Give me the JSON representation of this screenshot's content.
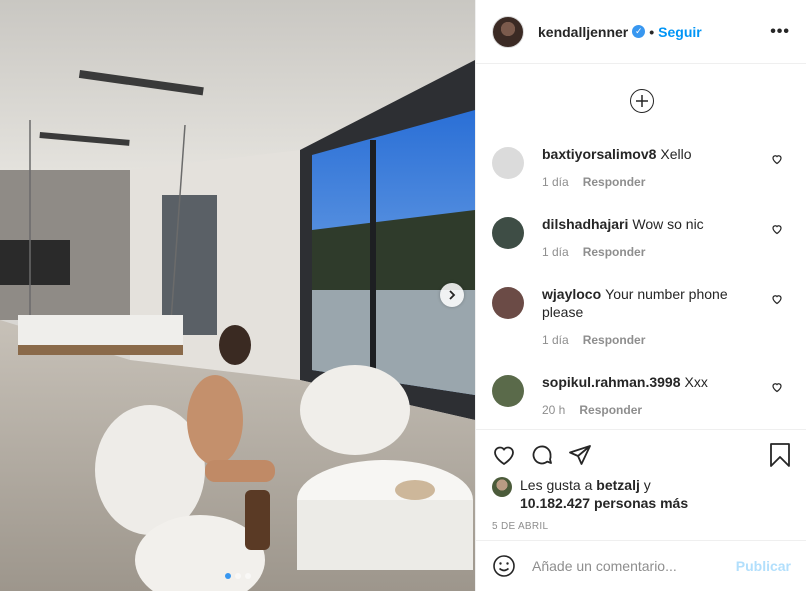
{
  "post": {
    "username": "kendalljenner",
    "verified_icon": "verified-badge-icon",
    "separator": "•",
    "follow_label": "Seguir",
    "more_icon": "more-options-icon"
  },
  "comments": [
    {
      "user": "baxtiyorsalimov8",
      "text": "Xello",
      "time": "1 día",
      "reply": "Responder",
      "avatar_color": "#dbdbdb"
    },
    {
      "user": "dilshadhajari",
      "text": "Wow so nic",
      "time": "1 día",
      "reply": "Responder",
      "avatar_color": "#3e4d45"
    },
    {
      "user": "wjayloco",
      "text": "Your number phone please",
      "time": "1 día",
      "reply": "Responder",
      "avatar_color": "#6b4b46"
    },
    {
      "user": "sopikul.rahman.3998",
      "text": "Xxx",
      "time": "20 h",
      "reply": "Responder",
      "avatar_color": "#5a6a4a"
    }
  ],
  "likes": {
    "prefix": "Les gusta a ",
    "user": "betzalj",
    "mid": " y",
    "count": "10.182.427 personas más"
  },
  "date": "5 DE ABRIL",
  "add_comment": {
    "placeholder": "Añade un comentario...",
    "publish_label": "Publicar"
  },
  "carousel": {
    "total": 3,
    "active": 1
  },
  "colors": {
    "accent": "#0095f6",
    "publish_disabled": "#b2dffc",
    "muted": "#8e8e8e"
  }
}
